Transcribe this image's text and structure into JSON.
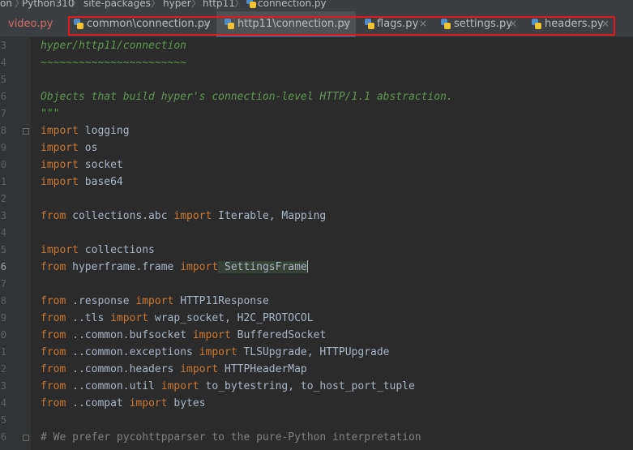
{
  "breadcrumb": {
    "items": [
      "on",
      "Python310",
      "site-packages",
      "hyper",
      "http11",
      "connection.py"
    ]
  },
  "tabs": [
    {
      "label": "video.py"
    },
    {
      "label": "common\\connection.py",
      "close": "×"
    },
    {
      "label": "http11\\connection.py",
      "close": "×"
    },
    {
      "label": "flags.py",
      "close": "×"
    },
    {
      "label": "settings.py",
      "close": "×"
    },
    {
      "label": "headers.py",
      "close": "×"
    }
  ],
  "gutter": {
    "line_numbers": [
      "3",
      "4",
      "5",
      "6",
      "7",
      "8",
      "9",
      "0",
      "1",
      "2",
      "3",
      "4",
      "5",
      "6",
      "7",
      "8",
      "9",
      "0",
      "1",
      "2",
      "3",
      "4",
      "5",
      "6"
    ]
  },
  "code": {
    "lines": [
      {
        "text": "hyper/http11/connection"
      },
      {
        "text": "~~~~~~~~~~~~~~~~~~~~~~~"
      },
      {
        "text": ""
      },
      {
        "text": "Objects that build hyper's connection-level HTTP/1.1 abstraction."
      },
      {
        "text": "\"\"\""
      },
      {
        "kw": "import",
        "rest": " logging"
      },
      {
        "kw": "import",
        "rest": " os"
      },
      {
        "kw": "import",
        "rest": " socket"
      },
      {
        "kw": "import",
        "rest": " base64"
      },
      {
        "text": ""
      },
      {
        "kw": "from",
        "mid": " collections.abc ",
        "kw2": "import",
        "rest": " Iterable, Mapping"
      },
      {
        "text": ""
      },
      {
        "kw": "import",
        "rest": " collections"
      },
      {
        "kw": "from",
        "mid": " hyperframe.frame ",
        "kw2": "import",
        "rest": " SettingsFrame"
      },
      {
        "text": ""
      },
      {
        "kw": "from",
        "mid": " .response ",
        "kw2": "import",
        "rest": " HTTP11Response"
      },
      {
        "kw": "from",
        "mid": " ..tls ",
        "kw2": "import",
        "rest": " wrap_socket, H2C_PROTOCOL"
      },
      {
        "kw": "from",
        "mid": " ..common.bufsocket ",
        "kw2": "import",
        "rest": " BufferedSocket"
      },
      {
        "kw": "from",
        "mid": " ..common.exceptions ",
        "kw2": "import",
        "rest": " TLSUpgrade, HTTPUpgrade"
      },
      {
        "kw": "from",
        "mid": " ..common.headers ",
        "kw2": "import",
        "rest": " HTTPHeaderMap"
      },
      {
        "kw": "from",
        "mid": " ..common.util ",
        "kw2": "import",
        "rest": " to_bytestring, to_host_port_tuple"
      },
      {
        "kw": "from",
        "mid": " ..compat ",
        "kw2": "import",
        "rest": " bytes"
      },
      {
        "text": ""
      },
      {
        "text": "# We prefer pycohttpparser to the pure-Python interpretation"
      }
    ]
  },
  "colors": {
    "background": "#2b2b2b",
    "keyword": "#cc7832",
    "docstring": "#629755",
    "comment": "#808080",
    "identifier": "#a9b7c6",
    "active_tab_underline": "#4a88c7",
    "annotation_box": "#e0191b"
  }
}
